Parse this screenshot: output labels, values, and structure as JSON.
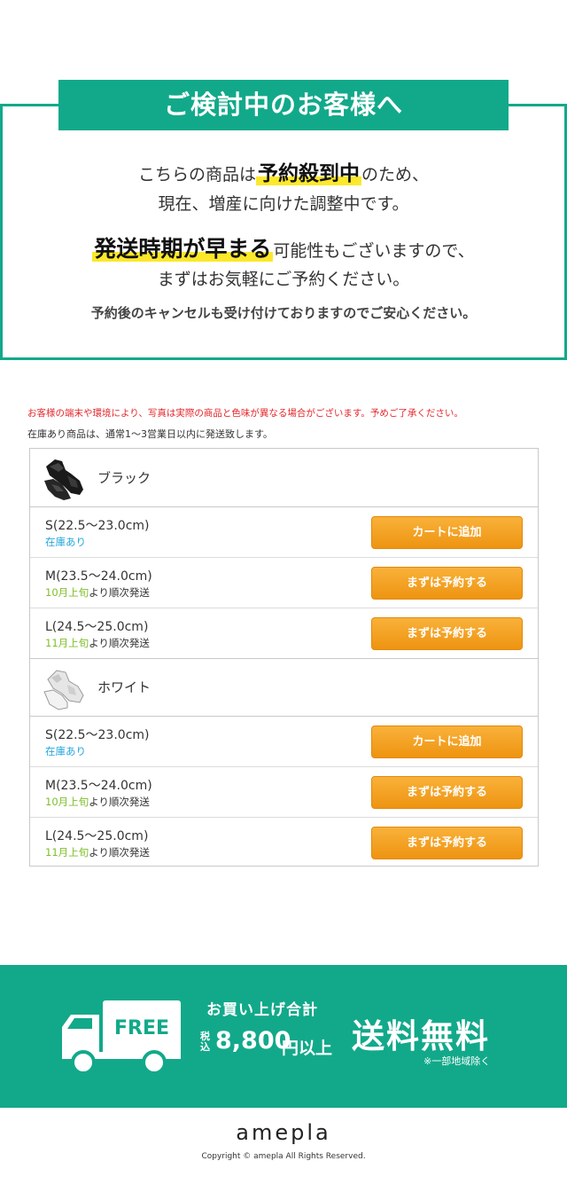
{
  "notice": {
    "title": "ご検討中のお客様へ",
    "line1_pre": "こちらの商品は",
    "line1_highlight": "予約殺到中",
    "line1_post": "のため、",
    "line2": "現在、増産に向けた調整中です。",
    "line3_highlight": "発送時期が早まる",
    "line3_post": "可能性もございますので、",
    "line4": "まずはお気軽にご予約ください。",
    "line5": "予約後のキャンセルも受け付けておりますのでご安心ください。"
  },
  "notes": {
    "warning": "お客様の端末や環境により、写真は実際の商品と色味が異なる場合がございます。予めご了承ください。",
    "shipping": "在庫あり商品は、通常1～3営業日以内に発送致します。"
  },
  "products": [
    {
      "color": "ブラック",
      "sizes": [
        {
          "label": "S(22.5～23.0cm)",
          "stock_highlight": "在庫あり",
          "stock_rest": "",
          "button": "カートに追加"
        },
        {
          "label": "M(23.5～24.0cm)",
          "stock_highlight": "10月上旬",
          "stock_rest": "より順次発送",
          "button": "まずは予約する"
        },
        {
          "label": "L(24.5～25.0cm)",
          "stock_highlight": "11月上旬",
          "stock_rest": "より順次発送",
          "button": "まずは予約する"
        }
      ]
    },
    {
      "color": "ホワイト",
      "sizes": [
        {
          "label": "S(22.5～23.0cm)",
          "stock_highlight": "在庫あり",
          "stock_rest": "",
          "button": "カートに追加"
        },
        {
          "label": "M(23.5～24.0cm)",
          "stock_highlight": "10月上旬",
          "stock_rest": "より順次発送",
          "button": "まずは予約する"
        },
        {
          "label": "L(24.5～25.0cm)",
          "stock_highlight": "11月上旬",
          "stock_rest": "より順次発送",
          "button": "まずは予約する"
        }
      ]
    }
  ],
  "banner": {
    "truck_label": "FREE",
    "line1": "お買い上げ合計",
    "tax": "税込",
    "amount": "8,800",
    "amount_suffix": "円以上",
    "headline": "送料無料",
    "note": "※一部地域除く"
  },
  "footer": {
    "logo": "amepla",
    "copyright": "Copyright © amepla All Rights Reserved."
  },
  "colors": {
    "brand_green": "#12a98a",
    "highlight_yellow": "#fce82a",
    "button_orange": "#f0a020",
    "warning_red": "#e5262a",
    "stock_blue": "#27a6de",
    "stock_green": "#7fbf2a"
  }
}
